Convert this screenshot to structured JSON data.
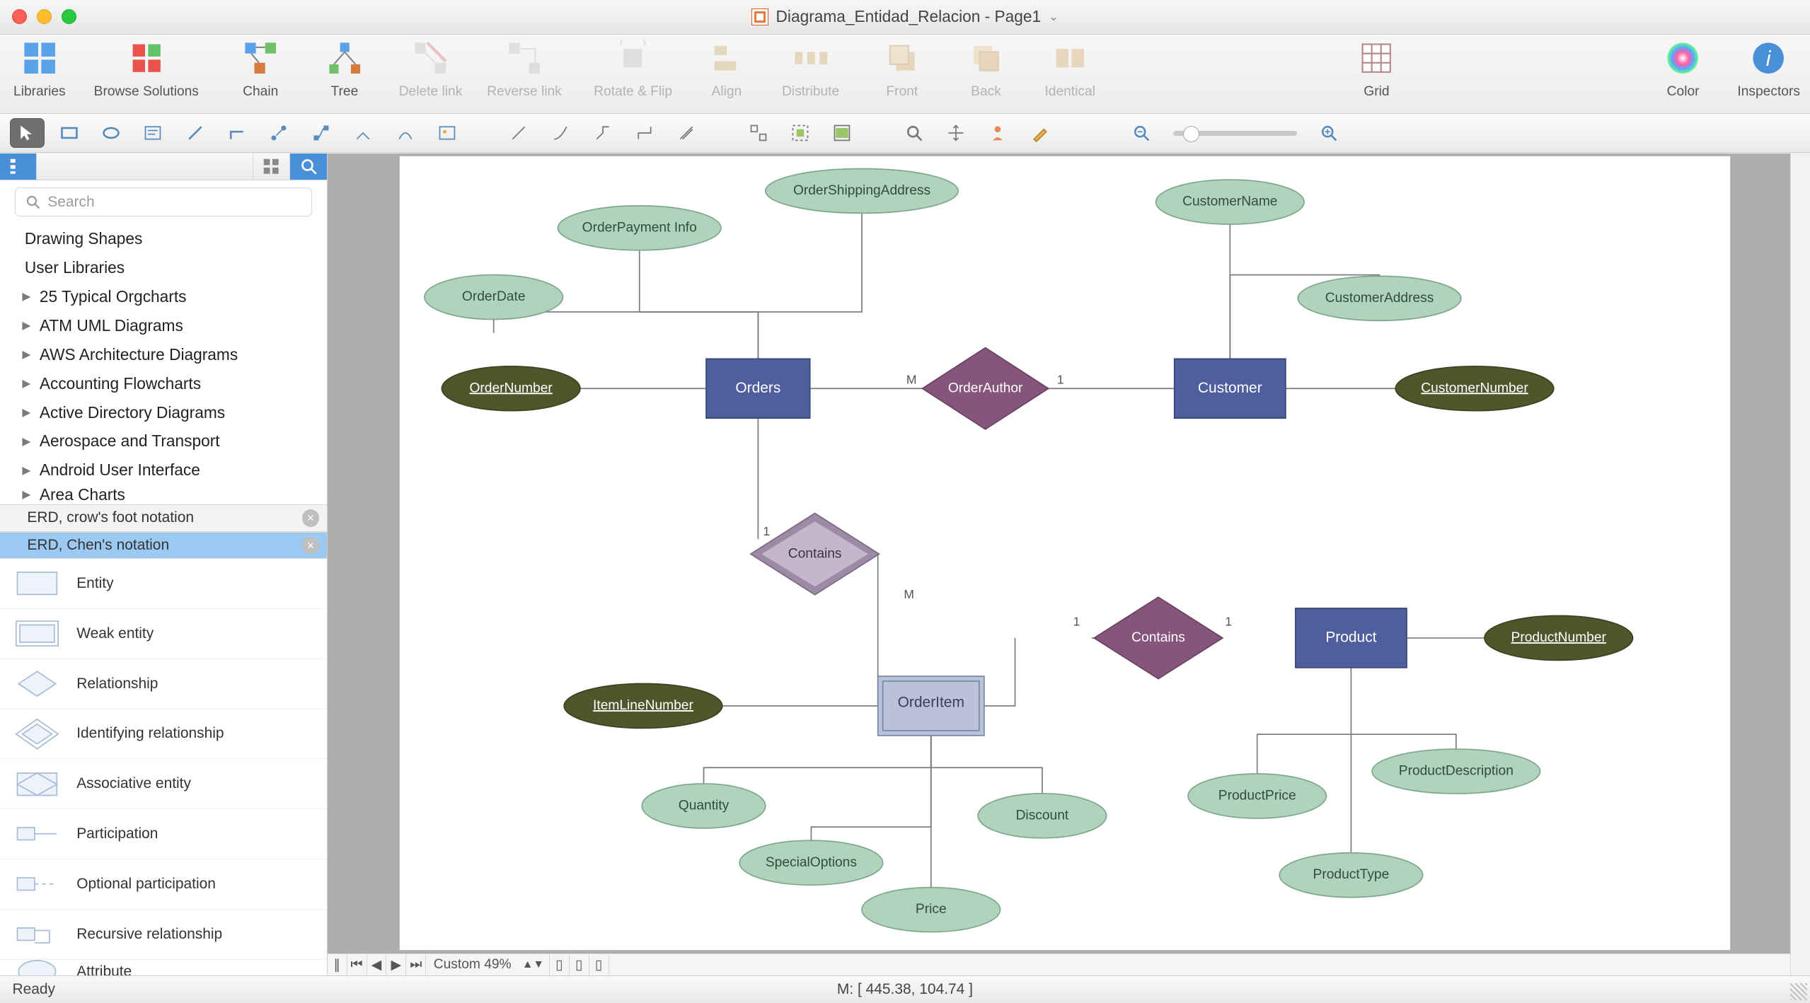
{
  "window": {
    "title": "Diagrama_Entidad_Relacion - Page1"
  },
  "toolbar": {
    "libraries": "Libraries",
    "browse": "Browse Solutions",
    "chain": "Chain",
    "tree": "Tree",
    "delete_link": "Delete link",
    "reverse_link": "Reverse link",
    "rotate_flip": "Rotate & Flip",
    "align": "Align",
    "distribute": "Distribute",
    "front": "Front",
    "back": "Back",
    "identical": "Identical",
    "grid": "Grid",
    "color": "Color",
    "inspectors": "Inspectors"
  },
  "sidebar": {
    "search_placeholder": "Search",
    "libs": [
      "Drawing Shapes",
      "User Libraries",
      "25 Typical Orgcharts",
      "ATM UML Diagrams",
      "AWS Architecture Diagrams",
      "Accounting Flowcharts",
      "Active Directory Diagrams",
      "Aerospace and Transport",
      "Android User Interface",
      "Area Charts"
    ],
    "stencil_tabs": {
      "a": "ERD, crow's foot notation",
      "b": "ERD, Chen's notation"
    },
    "shapes": [
      "Entity",
      "Weak entity",
      "Relationship",
      "Identifying relationship",
      "Associative entity",
      "Participation",
      "Optional participation",
      "Recursive relationship",
      "Attribute"
    ]
  },
  "bottom": {
    "zoom": "Custom 49%"
  },
  "status": {
    "ready": "Ready",
    "coords": "M: [ 445.38, 104.74 ]"
  },
  "erd": {
    "entities": {
      "orders": "Orders",
      "customer": "Customer",
      "orderitem": "OrderItem",
      "product": "Product"
    },
    "relationships": {
      "orderauthor": "OrderAuthor",
      "contains1": "Contains",
      "contains2": "Contains"
    },
    "attributes": {
      "orderdate": "OrderDate",
      "orderpayment": "OrderPayment Info",
      "ordershipping": "OrderShippingAddress",
      "customername": "CustomerName",
      "customeraddress": "CustomerAddress",
      "quantity": "Quantity",
      "specialoptions": "SpecialOptions",
      "price": "Price",
      "discount": "Discount",
      "productprice": "ProductPrice",
      "productdesc": "ProductDescription",
      "producttype": "ProductType"
    },
    "keys": {
      "ordernumber": "OrderNumber",
      "customernumber": "CustomerNumber",
      "itemlinenumber": "ItemLineNumber",
      "productnumber": "ProductNumber"
    },
    "card": {
      "m": "M",
      "one": "1"
    }
  }
}
